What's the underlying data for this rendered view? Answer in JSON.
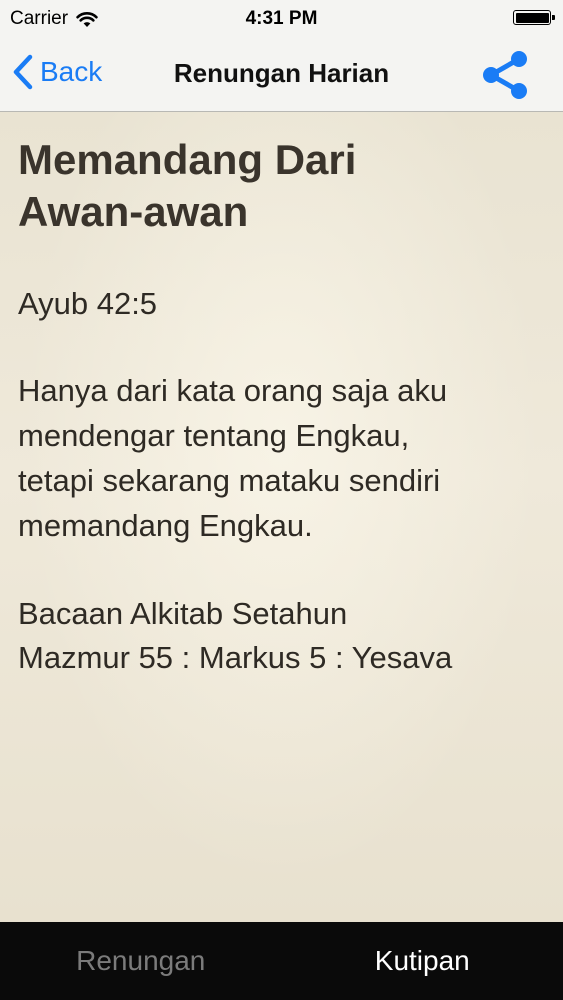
{
  "status_bar": {
    "carrier": "Carrier",
    "time": "4:31 PM",
    "wifi_icon": "wifi-icon",
    "battery_icon": "battery-icon",
    "battery_level": 1.0
  },
  "nav": {
    "back_label": "Back",
    "back_icon": "chevron-left-icon",
    "title": "Renungan Harian",
    "share_icon": "share-icon",
    "accent_color": "#1a7cf5"
  },
  "article": {
    "title_line1": "Memandang Dari",
    "title_line2": "Awan-awan",
    "verse_ref": "Ayub 42:5",
    "verse_lines": [
      "Hanya dari kata orang saja aku",
      "mendengar tentang Engkau,",
      "tetapi sekarang mataku sendiri",
      "memandang Engkau."
    ],
    "reading_title": "Bacaan Alkitab Setahun",
    "reading_refs": "Mazmur 55 : Markus 5 : Yesava"
  },
  "tabs": [
    {
      "label": "Renungan",
      "active": false
    },
    {
      "label": "Kutipan",
      "active": true
    }
  ]
}
